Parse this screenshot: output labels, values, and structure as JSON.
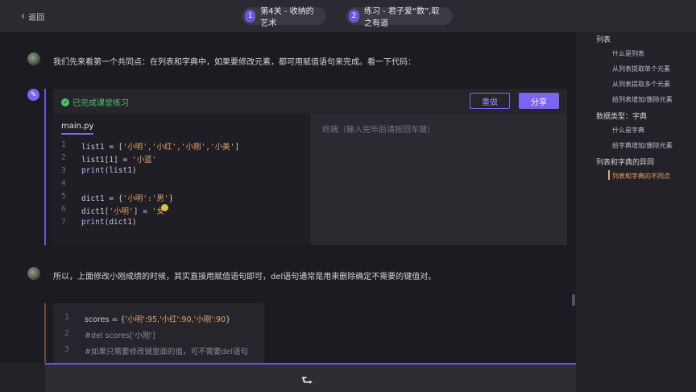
{
  "topbar": {
    "back_label": "返回",
    "steps": [
      {
        "num": "1",
        "label": "第4关 - 收纳的艺术"
      },
      {
        "num": "2",
        "label": "练习 - 君子爱“数”,取之有道"
      }
    ]
  },
  "main": {
    "msg1": "我们先来看第一个共同点：在列表和字典中，如果要修改元素，都可用赋值语句来完成。看一下代码：",
    "msg2": "所以，上面修改小刚成绩的时候，其实直接用赋值语句即可，del语句通常是用来删除确定不需要的键值对。"
  },
  "exercise": {
    "done_label": "已完成课堂练习",
    "reset_label": "重做",
    "share_label": "分享",
    "file_tab": "main.py",
    "terminal_placeholder": "终端（输入完毕后请按回车键）",
    "code": [
      {
        "n": "1",
        "pre": "list1 = [",
        "str": "'小明','小红','小刚','小美'",
        "post": "]"
      },
      {
        "n": "2",
        "pre": "list1[1] = ",
        "str": "'小蓝'",
        "post": ""
      },
      {
        "n": "3",
        "pre": "",
        "fn": "print",
        "post": "(list1)"
      },
      {
        "n": "4",
        "pre": "",
        "str": "",
        "post": ""
      },
      {
        "n": "5",
        "pre": "dict1 = {",
        "str": "'小明':'男'",
        "post": "}"
      },
      {
        "n": "6",
        "pre": "dict1[",
        "str": "'小明'",
        "post": "] = ",
        "str2": "'女'"
      },
      {
        "n": "7",
        "pre": "",
        "fn": "print",
        "post": "(dict1)"
      }
    ]
  },
  "snippet": {
    "code": [
      {
        "n": "1",
        "pre": "scores = {",
        "str": "'小明':95,'小红':90,'小刚':90",
        "post": "}"
      },
      {
        "n": "2",
        "comment": "#del scores['小刚']"
      },
      {
        "n": "3",
        "comment": "#如果只需要修改键里面的值，可不需要del语句"
      }
    ]
  },
  "bottombar": {
    "next_icon": "return-arrow-icon"
  },
  "toc": {
    "items": [
      {
        "label": "列表",
        "level": 1
      },
      {
        "label": "什么是列表",
        "level": 2
      },
      {
        "label": "从列表提取单个元素",
        "level": 2
      },
      {
        "label": "从列表提取多个元素",
        "level": 2
      },
      {
        "label": "给列表增加/删除元素",
        "level": 2
      },
      {
        "label": "数据类型：字典",
        "level": 1
      },
      {
        "label": "什么是字典",
        "level": 2
      },
      {
        "label": "给字典增加/删除元素",
        "level": 2
      },
      {
        "label": "列表和字典的异同",
        "level": 1
      },
      {
        "label": "列表和字典的不同点",
        "level": 2
      }
    ]
  },
  "colors": {
    "accent": "#7c63f2",
    "success": "#4fbf6a",
    "string": "#e8a366"
  }
}
